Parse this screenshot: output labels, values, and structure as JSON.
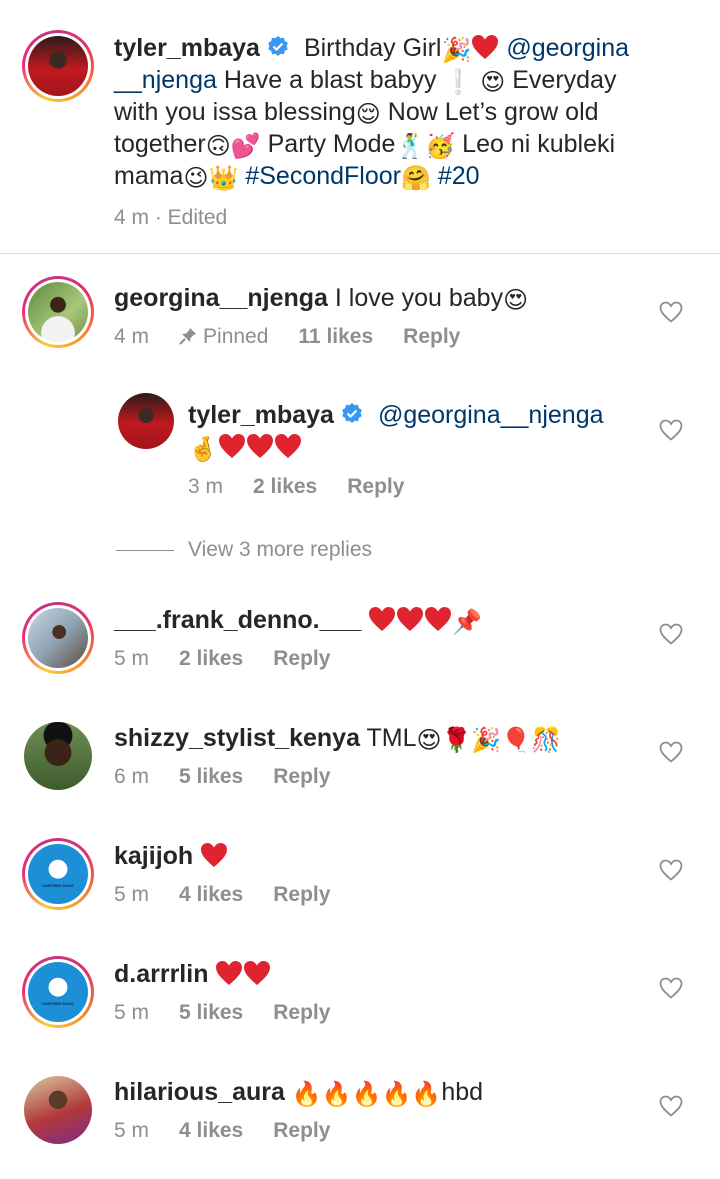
{
  "caption": {
    "username": "tyler_mbaya",
    "text_parts": {
      "p1": "Birthday Girl",
      "mention": "@georgina",
      "mention2": "__njenga",
      "p2": " Have a blast babyy",
      "p3": " Everyday",
      "p4": "with you issa blessing",
      "p5": " Now Let’s grow old",
      "p6": "together",
      "p7": " Party Mode",
      "p8": " Leo ni kubleki",
      "p9": "mama",
      "tag1": "#SecondFloor",
      "tag2": "#20"
    },
    "meta": "4 m · Edited"
  },
  "comments": [
    {
      "username": "georgina__njenga",
      "text": "I love you baby",
      "time": "4 m",
      "pinned": "Pinned",
      "likes": "11 likes",
      "reply": "Reply"
    },
    {
      "username": "tyler_mbaya",
      "mention": "@georgina__njenga",
      "time": "3 m",
      "likes": "2 likes",
      "reply": "Reply"
    },
    {
      "username": "___.frank_denno.___",
      "time": "5 m",
      "likes": "2 likes",
      "reply": "Reply"
    },
    {
      "username": "shizzy_stylist_kenya",
      "text": "TML",
      "time": "6 m",
      "likes": "5 likes",
      "reply": "Reply"
    },
    {
      "username": "kajijoh",
      "time": "5 m",
      "likes": "4 likes",
      "reply": "Reply"
    },
    {
      "username": "d.arrrlin",
      "time": "5 m",
      "likes": "5 likes",
      "reply": "Reply"
    },
    {
      "username": "hilarious_aura",
      "text": "hbd",
      "time": "5 m",
      "likes": "4 likes",
      "reply": "Reply"
    }
  ],
  "view_more": "View 3 more replies",
  "avatar_text": {
    "uniform": "UNIFORM GANG"
  },
  "colors": {
    "link": "#00376b",
    "meta": "#8e8e8e",
    "heart": "#e0242f",
    "verified": "#3897f0"
  }
}
